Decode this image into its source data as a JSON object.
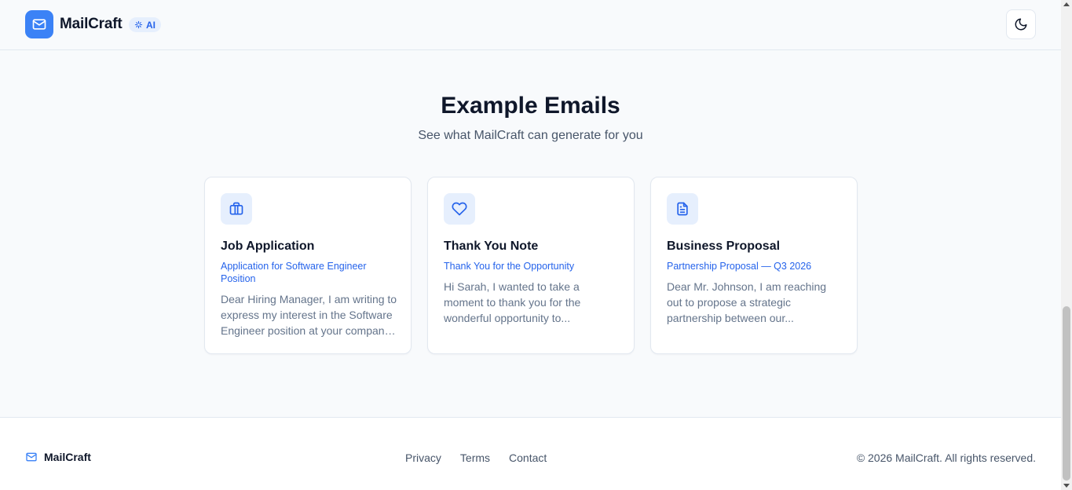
{
  "header": {
    "brand": "MailCraft",
    "badge": "AI",
    "icons": {
      "logo": "mail-icon",
      "badge": "sparkles-icon",
      "theme_toggle": "moon-icon"
    }
  },
  "section": {
    "title": "Example Emails",
    "subtitle": "See what MailCraft can generate for you"
  },
  "cards": [
    {
      "icon": "briefcase-icon",
      "title": "Job Application",
      "subject": "Application for Software Engineer Position",
      "preview": "Dear Hiring Manager, I am writing to express my interest in the Software Engineer position at your company and would welcome the opportunity."
    },
    {
      "icon": "heart-icon",
      "title": "Thank You Note",
      "subject": "Thank You for the Opportunity",
      "preview": "Hi Sarah, I wanted to take a moment to thank you for the wonderful opportunity to..."
    },
    {
      "icon": "document-icon",
      "title": "Business Proposal",
      "subject": "Partnership Proposal — Q3 2026",
      "preview": "Dear Mr. Johnson, I am reaching out to propose a strategic partnership between our..."
    }
  ],
  "footer": {
    "brand": "MailCraft",
    "links": [
      "Privacy",
      "Terms",
      "Contact"
    ],
    "copyright": "© 2026 MailCraft. All rights reserved."
  },
  "colors": {
    "accent": "#3b82f6",
    "accent_text": "#2563eb",
    "accent_soft": "#e6effd",
    "background": "#f8fafc",
    "text": "#0f172a",
    "muted": "#64748b"
  }
}
